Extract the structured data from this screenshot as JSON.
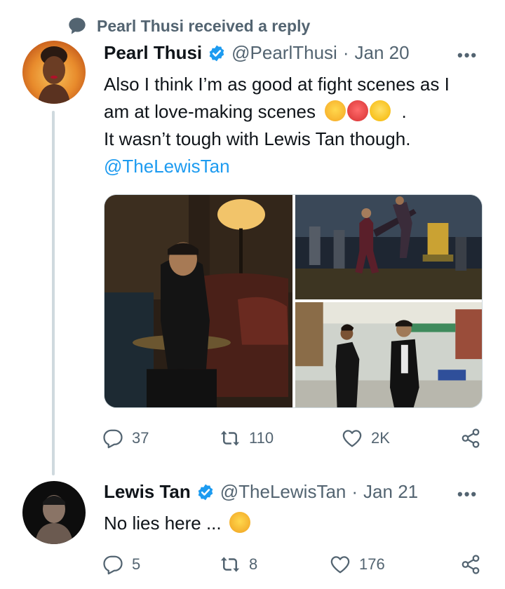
{
  "context": {
    "label": "Pearl Thusi received a reply",
    "icon": "speech-bubble-icon"
  },
  "tweet1": {
    "name": "Pearl Thusi",
    "handle": "@PearlThusi",
    "separator": "·",
    "date": "Jan 20",
    "more": "•••",
    "lines": [
      "Also I think I’m as good at fight scenes as I",
      "am at love-making scenes",
      "It wasn’t tough with Lewis Tan though."
    ],
    "line2_suffix": ".",
    "mention": "@TheLewisTan",
    "emojis": [
      "face-with-tears-of-joy-emoji",
      "hot-face-emoji",
      "zany-face-emoji"
    ],
    "media_alt": [
      "Man in leather jacket seated in armchair in dim lounge",
      "Fight scene with kick in crowded nightclub",
      "Woman and man in black walking on street"
    ],
    "stats": {
      "replies": "37",
      "retweets": "110",
      "likes": "2K"
    }
  },
  "tweet2": {
    "name": "Lewis Tan",
    "handle": "@TheLewisTan",
    "separator": "·",
    "date": "Jan 21",
    "more": "•••",
    "text": "No lies here ...",
    "emojis": [
      "face-with-hand-over-mouth-emoji"
    ],
    "stats": {
      "replies": "5",
      "retweets": "8",
      "likes": "176"
    }
  },
  "colors": {
    "verified": "#1d9bf0",
    "link": "#1d9bf0",
    "secondary": "#536471",
    "line": "#cfd9de"
  }
}
